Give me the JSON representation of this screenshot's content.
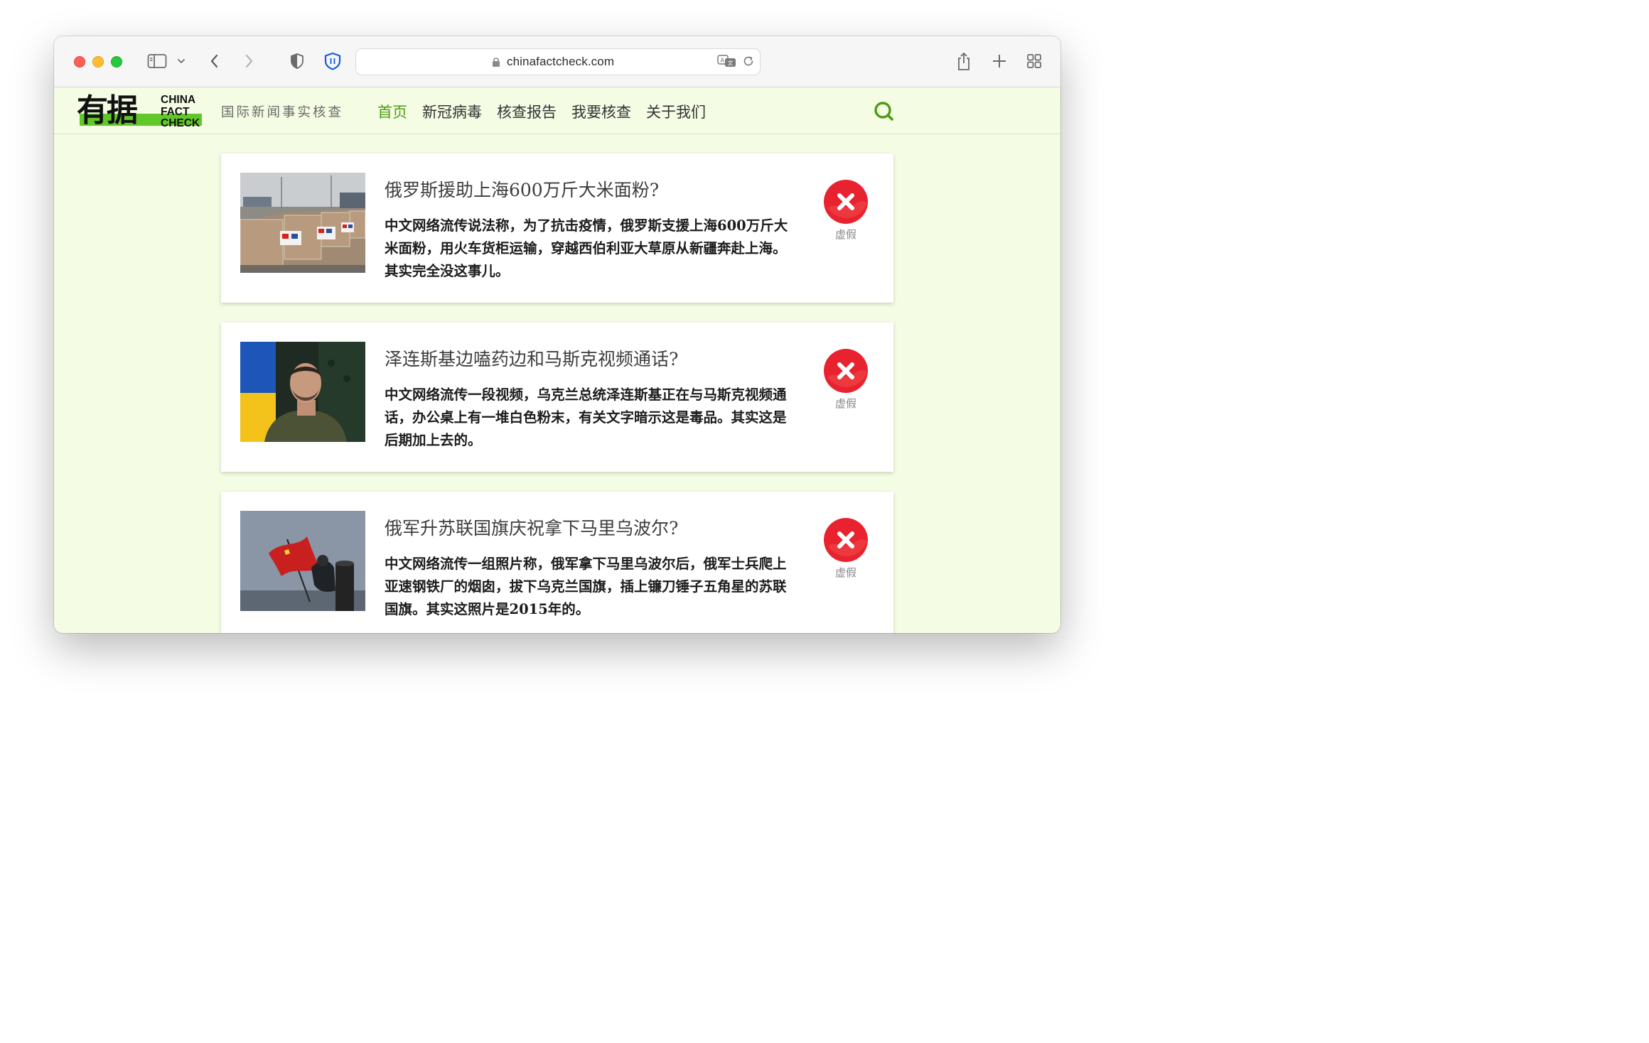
{
  "browser": {
    "url": "chinafactcheck.com"
  },
  "site": {
    "logo_cn": "有据",
    "logo_en_1": "CHINA",
    "logo_en_2": "FACT",
    "logo_en_3": "CHECK",
    "tagline": "国际新闻事实核查",
    "nav": [
      "首页",
      "新冠病毒",
      "核查报告",
      "我要核查",
      "关于我们"
    ],
    "active_nav": "首页"
  },
  "articles": [
    {
      "title": "俄罗斯援助上海600万斤大米面粉?",
      "summary": "中文网络流传说法称，为了抗击疫情，俄罗斯支援上海600万斤大米面粉，用火车货柜运输，穿越西伯利亚大草原从新疆奔赴上海。其实完全没这事儿。",
      "verdict": "虚假",
      "image": "pallets-with-china-russia-flags"
    },
    {
      "title": "泽连斯基边嗑药边和马斯克视频通话?",
      "summary": "中文网络流传一段视频，乌克兰总统泽连斯基正在与马斯克视频通话，办公桌上有一堆白色粉末，有关文字暗示这是毒品。其实这是后期加上去的。",
      "verdict": "虚假",
      "image": "zelensky-portrait"
    },
    {
      "title": "俄军升苏联国旗庆祝拿下马里乌波尔?",
      "summary": "中文网络流传一组照片称，俄军拿下马里乌波尔后，俄军士兵爬上亚速钢铁厂的烟囱，拔下乌克兰国旗，插上镰刀锤子五角星的苏联国旗。其实这照片是2015年的。",
      "verdict": "虚假",
      "image": "soviet-flag-on-chimney"
    }
  ],
  "colors": {
    "accent_green": "#4f9a12",
    "logo_green": "#62c72a",
    "page_bg": "#f4fce4",
    "verdict_red": "#e8232f"
  }
}
